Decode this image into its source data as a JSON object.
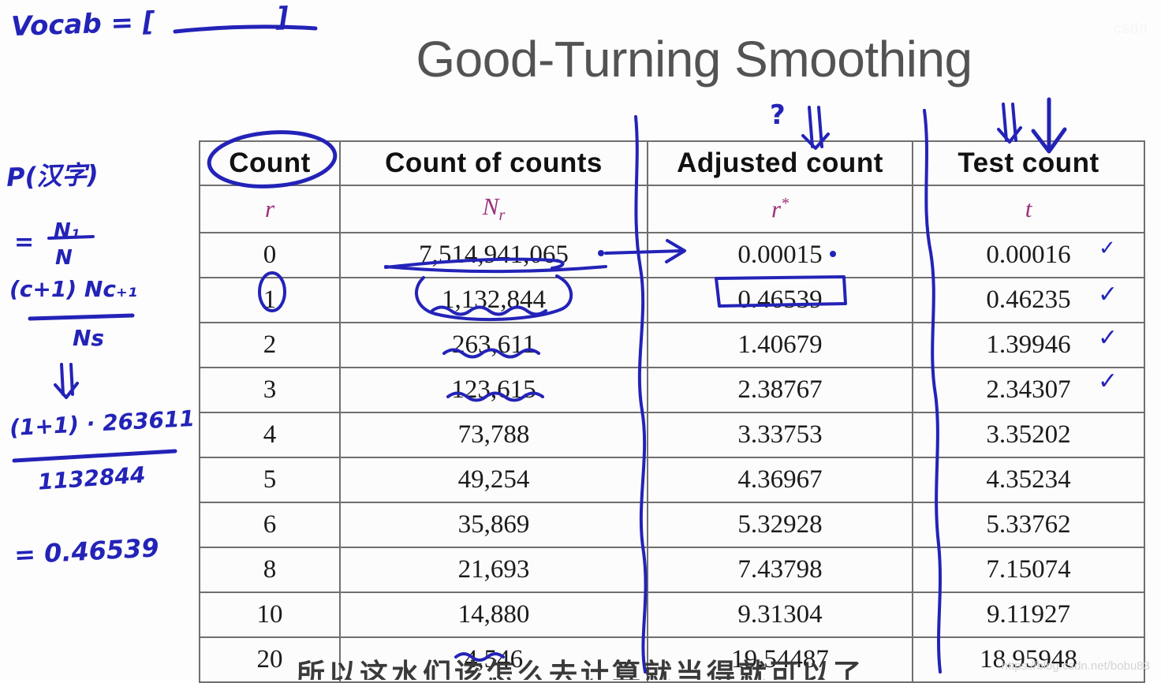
{
  "slide": {
    "title": "Good-Turning Smoothing",
    "bottom_caption": "所以这水们该怎么去计算就当得就可以了",
    "watermark_bottom": "https://blog.csdn.net/bobu83",
    "watermark_top": "csdn"
  },
  "table": {
    "headers": [
      "Count",
      "Count of counts",
      "Adjusted count",
      "Test count"
    ],
    "symbols": {
      "count": "r",
      "count_of_counts_base": "N",
      "count_of_counts_sub": "r",
      "adjusted_base": "r",
      "adjusted_sup": "*",
      "test": "t"
    },
    "rows": [
      {
        "count": "0",
        "count_of_counts": "7,514,941,065",
        "adjusted_count": "0.00015",
        "test_count": "0.00016"
      },
      {
        "count": "1",
        "count_of_counts": "1,132,844",
        "adjusted_count": "0.46539",
        "test_count": "0.46235"
      },
      {
        "count": "2",
        "count_of_counts": "263,611",
        "adjusted_count": "1.40679",
        "test_count": "1.39946"
      },
      {
        "count": "3",
        "count_of_counts": "123,615",
        "adjusted_count": "2.38767",
        "test_count": "2.34307"
      },
      {
        "count": "4",
        "count_of_counts": "73,788",
        "adjusted_count": "3.33753",
        "test_count": "3.35202"
      },
      {
        "count": "5",
        "count_of_counts": "49,254",
        "adjusted_count": "4.36967",
        "test_count": "4.35234"
      },
      {
        "count": "6",
        "count_of_counts": "35,869",
        "adjusted_count": "5.32928",
        "test_count": "5.33762"
      },
      {
        "count": "8",
        "count_of_counts": "21,693",
        "adjusted_count": "7.43798",
        "test_count": "7.15074"
      },
      {
        "count": "10",
        "count_of_counts": "14,880",
        "adjusted_count": "9.31304",
        "test_count": "9.11927"
      },
      {
        "count": "20",
        "count_of_counts": "4,546",
        "adjusted_count": "19.54487",
        "test_count": "18.95948"
      }
    ]
  },
  "annotations": {
    "vocab": "Vocab = [",
    "vocab_close": "]",
    "probability": "P(汉字)",
    "equals": "=",
    "frac1_num": "N₁",
    "frac1_den": "N",
    "frac2_num": "(c+1) Nᴄ₊₁",
    "frac2_den": "Nꜱ",
    "frac3_num": "(1+1) · 263611",
    "frac3_den": "1132844",
    "result": "= 0.46539",
    "question_mark": "?",
    "checkmarks": [
      "✓",
      "✓",
      "✓",
      "✓"
    ]
  },
  "colors": {
    "ink": "#2323b8",
    "symbol": "#9c2f7a",
    "title": "#535353",
    "table_border": "#6f6f6f"
  }
}
